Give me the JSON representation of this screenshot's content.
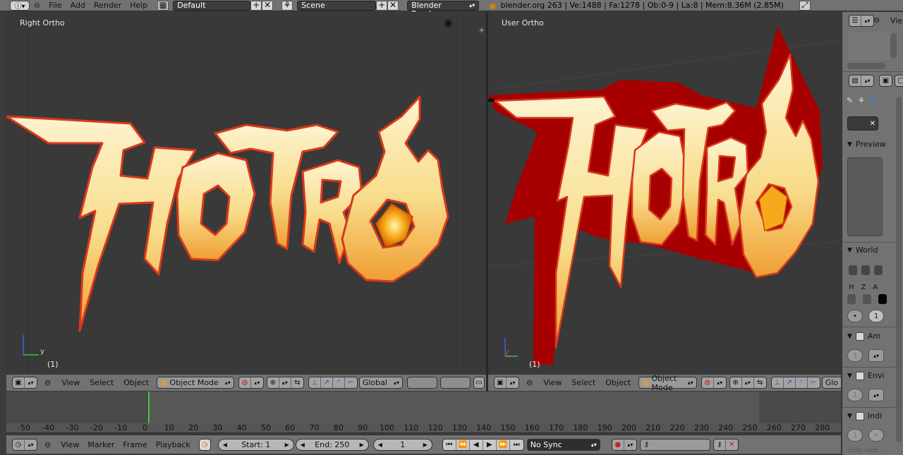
{
  "info_bar": {
    "menus": [
      "File",
      "Add",
      "Render",
      "Help"
    ],
    "screen_layout": "Default",
    "scene": "Scene",
    "render_engine": "Blender Render",
    "stats": "blender.org 263 | Ve:1488 | Fa:1278 | Ob:0-9 | La:8 | Mem:8.36M (2.85M)"
  },
  "viewport_left": {
    "label": "Right Ortho",
    "frame": "(1)",
    "axis_y": "y"
  },
  "viewport_right": {
    "label": "User Ortho",
    "frame": "(1)"
  },
  "logo_text": "HOTRO",
  "header_left": {
    "menus": [
      "View",
      "Select",
      "Object"
    ],
    "mode": "Object Mode",
    "orientation": "Global"
  },
  "header_right": {
    "menus": [
      "View",
      "Select",
      "Object"
    ],
    "mode": "Object Mode",
    "orientation_truncated": "Glo"
  },
  "timeline": {
    "ticks": [
      "-50",
      "-40",
      "-30",
      "-20",
      "-10",
      "0",
      "10",
      "20",
      "30",
      "40",
      "50",
      "60",
      "70",
      "80",
      "90",
      "100",
      "110",
      "120",
      "130",
      "140",
      "150",
      "160",
      "170",
      "180",
      "190",
      "200",
      "210",
      "220",
      "230",
      "240",
      "250",
      "260",
      "270",
      "280"
    ],
    "menus": [
      "View",
      "Marker",
      "Frame",
      "Playback"
    ],
    "start": "Start: 1",
    "end": "End: 250",
    "current": "1",
    "sync": "No Sync"
  },
  "sidebar": {
    "view_tab": "Vie",
    "preview": "Preview",
    "world": "World",
    "hza": [
      "H",
      "Z",
      "A"
    ],
    "counter": "1",
    "panels": [
      "Am",
      "Envi",
      "Indi"
    ],
    "bottom_text": "Only vert..."
  },
  "colors": {
    "viewport_bg": "#393939",
    "header_bg": "#727272",
    "timeline_cursor": "#45c445",
    "logo_fill_top": "#fdf1c8",
    "logo_fill_bottom": "#f0a63a",
    "logo_outline": "#d9381c",
    "extrude_red": "#a70000"
  }
}
